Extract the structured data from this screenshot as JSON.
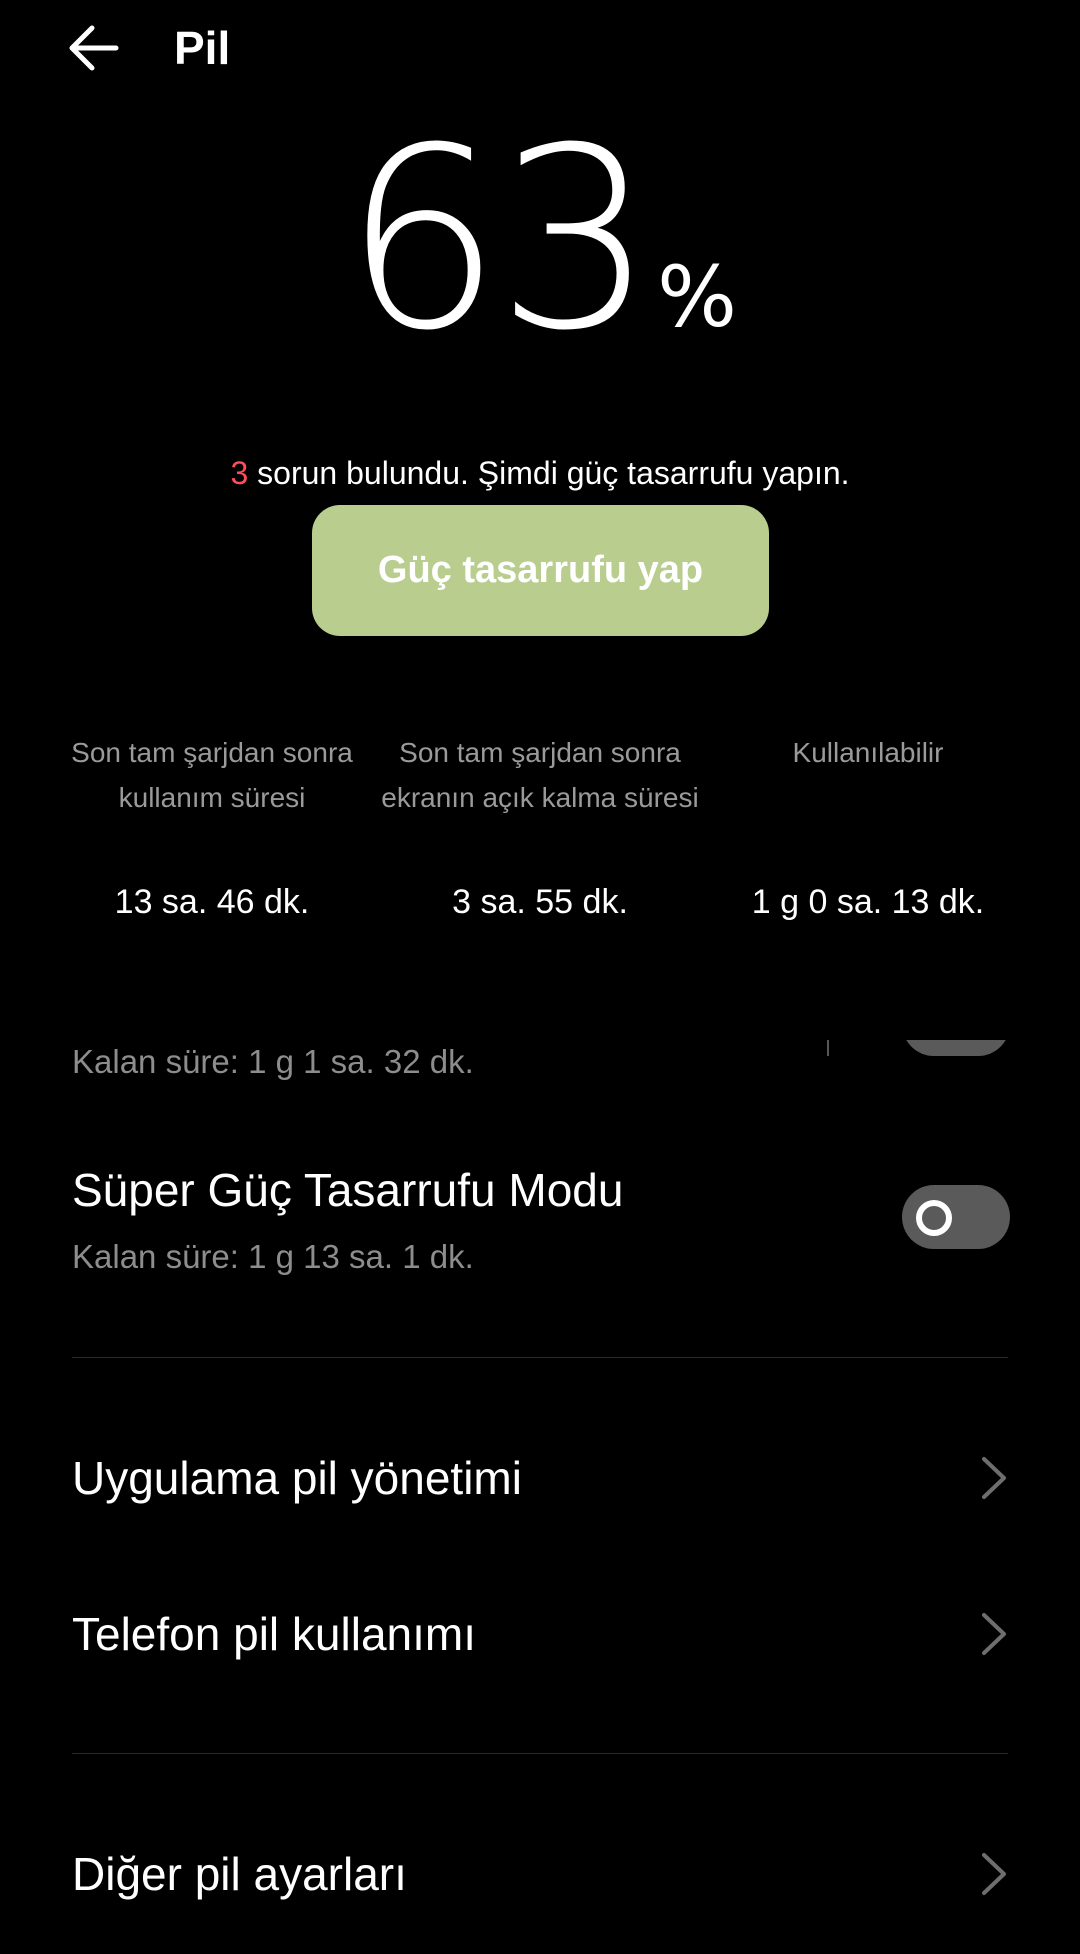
{
  "header": {
    "title": "Pil"
  },
  "battery": {
    "percent": "63",
    "unit": "%"
  },
  "issues": {
    "count": "3",
    "message": " sorun bulundu. Şimdi güç tasarrufu yapın."
  },
  "save_button": {
    "label": "Güç tasarrufu yap"
  },
  "stats": [
    {
      "label": "Son tam şarjdan sonra kullanım süresi",
      "value": "13 sa. 46 dk."
    },
    {
      "label": "Son tam şarjdan sonra ekranın açık kalma süresi",
      "value": "3 sa. 55 dk."
    },
    {
      "label": "Kullanılabilir",
      "value": "1 g 0 sa. 13 dk."
    }
  ],
  "power_saving": {
    "remaining": "Kalan süre:  1 g 1 sa. 32 dk."
  },
  "super_power_saving": {
    "title": "Süper Güç Tasarrufu Modu",
    "remaining": "Kalan süre:  1 g 13 sa. 1 dk.",
    "enabled": false
  },
  "menu": {
    "app_battery": "Uygulama pil yönetimi",
    "phone_battery": "Telefon pil kullanımı",
    "other_settings": "Diğer pil ayarları"
  },
  "colors": {
    "background": "#000000",
    "accent_button": "#b8cd8e",
    "issue_count": "#ff4d5a",
    "toggle_off": "#5a5a5a"
  }
}
